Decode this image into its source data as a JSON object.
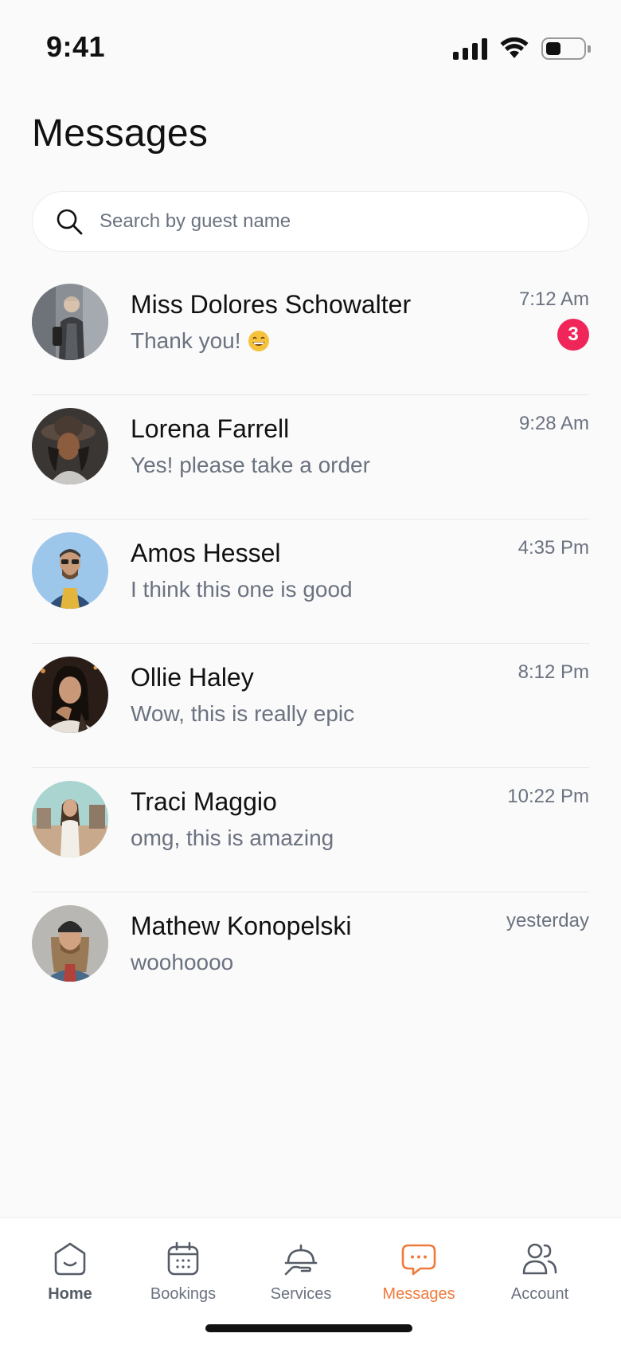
{
  "status_bar": {
    "time": "9:41"
  },
  "page": {
    "title": "Messages"
  },
  "search": {
    "placeholder": "Search by guest name"
  },
  "conversations": [
    {
      "name": "Miss Dolores Schowalter",
      "preview": "Thank you!",
      "preview_emoji": "grinning-face-icon",
      "time": "7:12 Am",
      "unread": "3"
    },
    {
      "name": "Lorena Farrell",
      "preview": "Yes! please take a order",
      "time": "9:28 Am"
    },
    {
      "name": "Amos Hessel",
      "preview": "I think this one is good",
      "time": "4:35 Pm"
    },
    {
      "name": "Ollie Haley",
      "preview": "Wow, this is really epic",
      "time": "8:12 Pm"
    },
    {
      "name": "Traci Maggio",
      "preview": "omg, this is amazing",
      "time": "10:22 Pm"
    },
    {
      "name": "Mathew Konopelski",
      "preview": "woohoooo",
      "time": "yesterday"
    }
  ],
  "tab_bar": {
    "tabs": [
      {
        "label": "Home",
        "icon": "home-icon"
      },
      {
        "label": "Bookings",
        "icon": "calendar-icon"
      },
      {
        "label": "Services",
        "icon": "cloche-service-icon"
      },
      {
        "label": "Messages",
        "icon": "chat-bubble-icon",
        "active": true
      },
      {
        "label": "Account",
        "icon": "users-icon"
      }
    ]
  },
  "colors": {
    "accent": "#f07a3c",
    "badge": "#f0265a",
    "muted_text": "#6b7280"
  }
}
